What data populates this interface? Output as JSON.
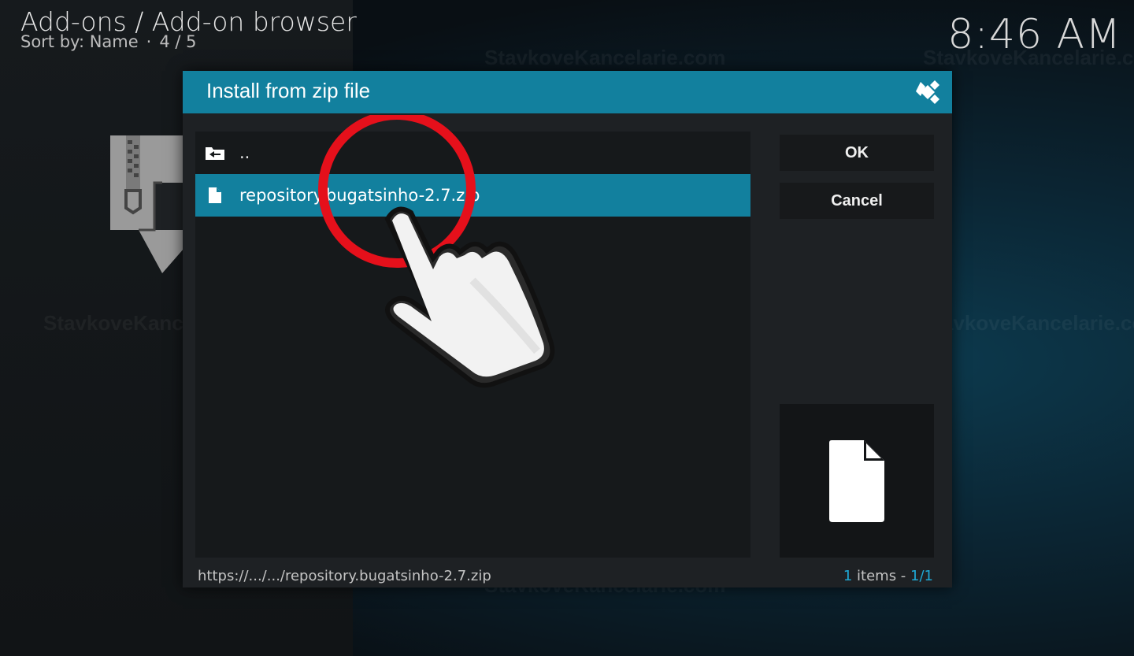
{
  "header": {
    "title": "Add-ons / Add-on browser",
    "sort_label": "Sort by: Name",
    "position": "4 / 5"
  },
  "clock": "8:46 AM",
  "watermark": "StavkoveKancelarie.com",
  "dialog": {
    "title": "Install from zip file",
    "items": [
      {
        "label": "..",
        "icon": "folder-back-icon"
      },
      {
        "label": "repository.bugatsinho-2.7.zip",
        "icon": "file-icon",
        "selected": true
      }
    ],
    "ok_label": "OK",
    "cancel_label": "Cancel",
    "footer_path": "https://.../.../repository.bugatsinho-2.7.zip",
    "count_num": "1",
    "count_text": " items - ",
    "count_page": "1/1"
  },
  "colors": {
    "accent": "#12809e",
    "highlight_text": "#1fa7d3",
    "circle": "#e5101b"
  }
}
